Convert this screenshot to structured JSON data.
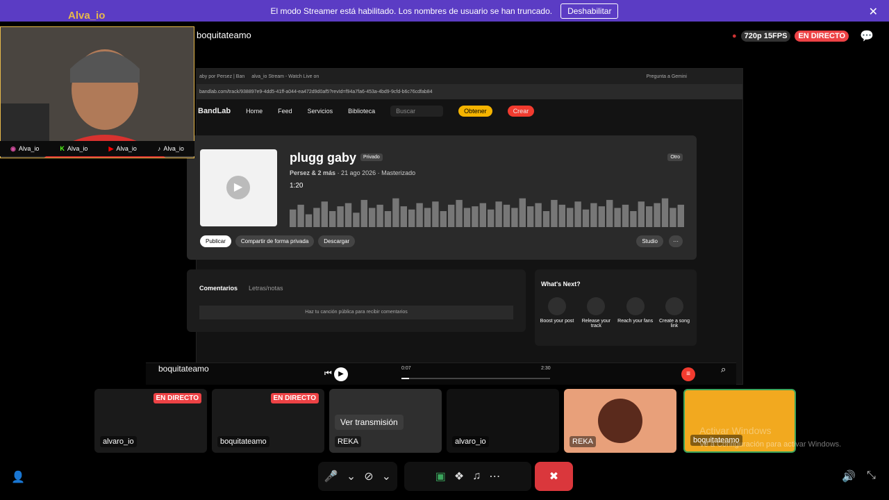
{
  "banner": {
    "message": "El modo Streamer está habilitado. Los nombres de usuario se han truncado.",
    "button": "Deshabilitar"
  },
  "streamer": {
    "name": "Alva_io",
    "socials": [
      "Alva_io",
      "Alva_io",
      "Alva_io",
      "Alva_io"
    ]
  },
  "stream": {
    "title": "boquitateamo",
    "quality": "720p 15FPS",
    "live": "EN DIRECTO"
  },
  "browser": {
    "tabs": [
      "aby por Persez | Ban",
      "alva_io Stream - Watch Live on",
      "Pregunta a Gemini"
    ],
    "url": "bandlab.com/track/938897e9-4dd5-41ff-a044-ea472d9d0af5?revId=f94a7fa6-453a-4bd9-9cfd-b6c76cdfab84",
    "nav": {
      "brand": "BandLab",
      "items": [
        "Home",
        "Feed",
        "Servicios",
        "Biblioteca"
      ],
      "search": "Buscar",
      "obtener": "Obtener",
      "crear": "Crear"
    }
  },
  "track": {
    "title": "plugg gaby",
    "privacy": "Privado",
    "tag": "Otro",
    "artist": "Persez & 2 más",
    "meta": "· 21 ago 2026 · Masterizado",
    "duration": "1:20",
    "actions": [
      "Publicar",
      "Compartir de forma privada",
      "Descargar"
    ],
    "studio": "Studio",
    "waveform": [
      0.55,
      0.7,
      0.4,
      0.6,
      0.8,
      0.5,
      0.65,
      0.75,
      0.45,
      0.85,
      0.6,
      0.7,
      0.5,
      0.9,
      0.65,
      0.55,
      0.75,
      0.6,
      0.8,
      0.5,
      0.7,
      0.85,
      0.6,
      0.65,
      0.75,
      0.55,
      0.8,
      0.7,
      0.6,
      0.9,
      0.65,
      0.75,
      0.5,
      0.85,
      0.7,
      0.6,
      0.8,
      0.55,
      0.75,
      0.65,
      0.85,
      0.6,
      0.7,
      0.5,
      0.8,
      0.65,
      0.75,
      0.9,
      0.6,
      0.7
    ]
  },
  "comments": {
    "tabs": [
      "Comentarios",
      "Letras/notas"
    ],
    "notice": "Haz tu canción pública para recibir comentarios"
  },
  "next": {
    "title": "What's Next?",
    "items": [
      {
        "label": "Boost your post",
        "icon": "lightning-icon"
      },
      {
        "label": "Release your track",
        "icon": "release-icon"
      },
      {
        "label": "Reach your fans",
        "icon": "mail-icon"
      },
      {
        "label": "Create a song link",
        "icon": "link-icon"
      }
    ]
  },
  "player": {
    "label": "boquitateamo",
    "elapsed": "0:07",
    "total": "2:30",
    "progress": 0.05
  },
  "tiles": [
    {
      "label": "alvaro_io",
      "live": "EN DIRECTO",
      "bg": "#1a1a1a"
    },
    {
      "label": "boquitateamo",
      "live": "EN DIRECTO",
      "bg": "#1a1a1a"
    },
    {
      "label": "REKA",
      "button": "Ver transmisión",
      "bg": "#2f2f2f"
    },
    {
      "label": "alvaro_io",
      "bg": "#111111"
    },
    {
      "label": "REKA",
      "bg": "#e8a07a"
    },
    {
      "label": "boquitateamo",
      "bg": "#f2a91f"
    }
  ],
  "windows": {
    "line1": "Activar Windows",
    "line2": "Ve a Configuración para activar Windows."
  }
}
